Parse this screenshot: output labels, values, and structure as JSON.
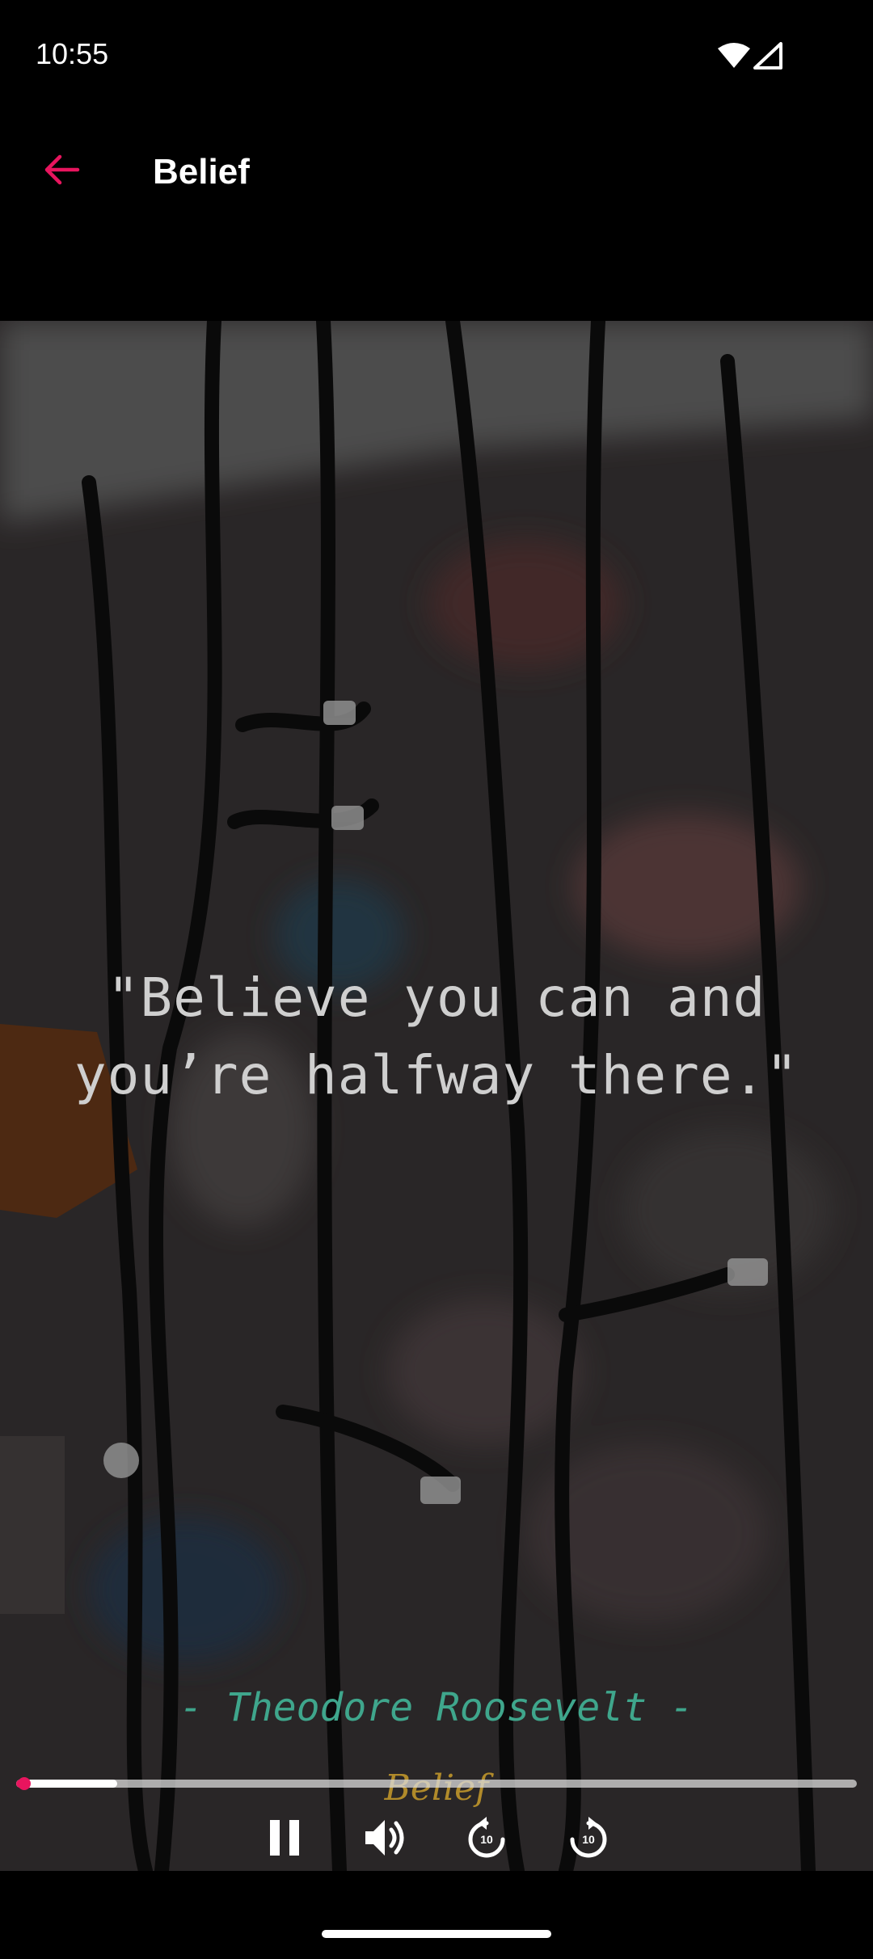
{
  "status_bar": {
    "time": "10:55"
  },
  "app_bar": {
    "title": "Belief",
    "back_icon": "arrow-left-icon",
    "accent": "#e8155e"
  },
  "video": {
    "quote_line1": "\"Believe you can and",
    "quote_line2": "you’re halfway there.\"",
    "author": "- Theodore Roosevelt -",
    "caption": "Belief",
    "progress_played": 0.01,
    "progress_buffered": 0.12
  },
  "controls": {
    "pause_icon": "pause-icon",
    "volume_icon": "volume-icon",
    "rewind_icon": "replay-10-icon",
    "rewind_label": "10",
    "forward_icon": "forward-10-icon",
    "forward_label": "10"
  }
}
